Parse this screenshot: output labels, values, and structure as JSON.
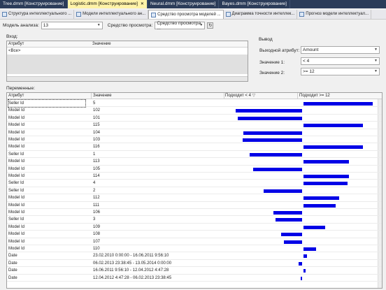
{
  "doc_tabs": [
    {
      "label": "Tree.dmm [Конструирование]",
      "active": false
    },
    {
      "label": "Logistic.dmm [Конструирование]",
      "active": true
    },
    {
      "label": "Neural.dmm [Конструирование]",
      "active": false
    },
    {
      "label": "Bayes.dmm [Конструирование]",
      "active": false
    }
  ],
  "viewer_tabs": [
    "Структура интеллектуального ...",
    "Модели интеллектуального ан...",
    "Средство просмотра моделей ...",
    "Диаграмма точности интеллек...",
    "Прогноз модели интеллектуал..."
  ],
  "toolbar": {
    "model_label": "Модель анализа:",
    "model_value": "13",
    "viewer_label": "Средство просмотра:",
    "viewer_value": "Средство просмотра ..."
  },
  "input": {
    "section_label": "Вход:",
    "col_attribute": "Атрибут",
    "col_value": "Значение",
    "row_attribute": "<Все>",
    "row_value": ""
  },
  "output": {
    "section_label": "Вывод",
    "attribute_label": "Выходной атрибут:",
    "attribute_value": "Amount",
    "value1_label": "Значение 1:",
    "value1": "< 4",
    "value2_label": "Значение 2:",
    "value2": ">= 12"
  },
  "variables": {
    "section_label": "Переменные:",
    "col_attribute": "Атрибут",
    "col_value": "Значение",
    "col_favors1": "Подходит < 4",
    "col_favors2": "Подходит >= 12",
    "rows": [
      {
        "attribute": "Seller Id",
        "value": "5",
        "favors1": 0,
        "favors2": 1.0
      },
      {
        "attribute": "Model Id",
        "value": "102",
        "favors1": 1.0,
        "favors2": 0
      },
      {
        "attribute": "Model Id",
        "value": "101",
        "favors1": 0.97,
        "favors2": 0
      },
      {
        "attribute": "Model Id",
        "value": "115",
        "favors1": 0,
        "favors2": 0.86
      },
      {
        "attribute": "Model Id",
        "value": "104",
        "favors1": 0.88,
        "favors2": 0
      },
      {
        "attribute": "Model Id",
        "value": "103",
        "favors1": 0.9,
        "favors2": 0
      },
      {
        "attribute": "Model Id",
        "value": "116",
        "favors1": 0,
        "favors2": 0.86
      },
      {
        "attribute": "Seller Id",
        "value": "1",
        "favors1": 0.79,
        "favors2": 0
      },
      {
        "attribute": "Model Id",
        "value": "113",
        "favors1": 0,
        "favors2": 0.66
      },
      {
        "attribute": "Model Id",
        "value": "105",
        "favors1": 0.74,
        "favors2": 0
      },
      {
        "attribute": "Model Id",
        "value": "114",
        "favors1": 0,
        "favors2": 0.66
      },
      {
        "attribute": "Seller Id",
        "value": "4",
        "favors1": 0,
        "favors2": 0.64
      },
      {
        "attribute": "Seller Id",
        "value": "2",
        "favors1": 0.58,
        "favors2": 0
      },
      {
        "attribute": "Model Id",
        "value": "112",
        "favors1": 0,
        "favors2": 0.52
      },
      {
        "attribute": "Model Id",
        "value": "111",
        "favors1": 0,
        "favors2": 0.46
      },
      {
        "attribute": "Model Id",
        "value": "106",
        "favors1": 0.43,
        "favors2": 0
      },
      {
        "attribute": "Seller Id",
        "value": "3",
        "favors1": 0.4,
        "favors2": 0
      },
      {
        "attribute": "Model Id",
        "value": "109",
        "favors1": 0,
        "favors2": 0.31
      },
      {
        "attribute": "Model Id",
        "value": "108",
        "favors1": 0.32,
        "favors2": 0
      },
      {
        "attribute": "Model Id",
        "value": "107",
        "favors1": 0.27,
        "favors2": 0
      },
      {
        "attribute": "Model Id",
        "value": "110",
        "favors1": 0,
        "favors2": 0.18
      },
      {
        "attribute": "Date",
        "value": "23.02.2010 0:00:00 - 16.06.2011 9:56:10",
        "favors1": 0,
        "favors2": 0.05
      },
      {
        "attribute": "Date",
        "value": "06.02.2013 23:38:45 - 13.05.2014 0:00:00",
        "favors1": 0.05,
        "favors2": 0
      },
      {
        "attribute": "Date",
        "value": "16.06.2011 9:56:10 - 12.04.2012 4:47:28",
        "favors1": 0,
        "favors2": 0.03
      },
      {
        "attribute": "Date",
        "value": "12.04.2012 4:47:28 - 06.02.2013 23:38:45",
        "favors1": 0.02,
        "favors2": 0
      }
    ]
  }
}
